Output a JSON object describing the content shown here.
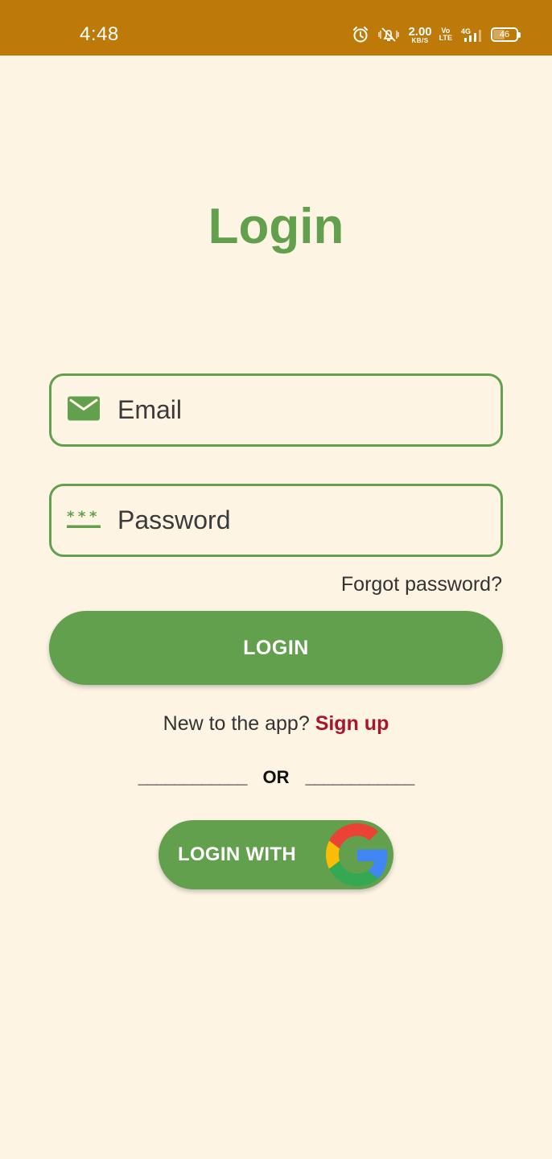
{
  "status_bar": {
    "time": "4:48",
    "net_speed_value": "2.00",
    "net_speed_unit": "KB/S",
    "volte_top": "Vo",
    "volte_bottom": "LTE",
    "network": "4G",
    "battery": "46"
  },
  "title": "Login",
  "email_field": {
    "placeholder": "Email",
    "icon": "mail-icon"
  },
  "password_field": {
    "placeholder": "Password",
    "icon": "password-icon"
  },
  "forgot_password": "Forgot password?",
  "login_button": "LOGIN",
  "signup": {
    "prompt": "New to the app?",
    "link": "Sign up"
  },
  "divider": {
    "left": "____________",
    "text": "OR",
    "right": "____________"
  },
  "google_button": {
    "label": "LOGIN WITH",
    "icon": "google-icon"
  },
  "colors": {
    "status_bar": "#bd7a08",
    "background": "#fdf4e4",
    "primary": "#62a04d",
    "link": "#a8162b"
  }
}
